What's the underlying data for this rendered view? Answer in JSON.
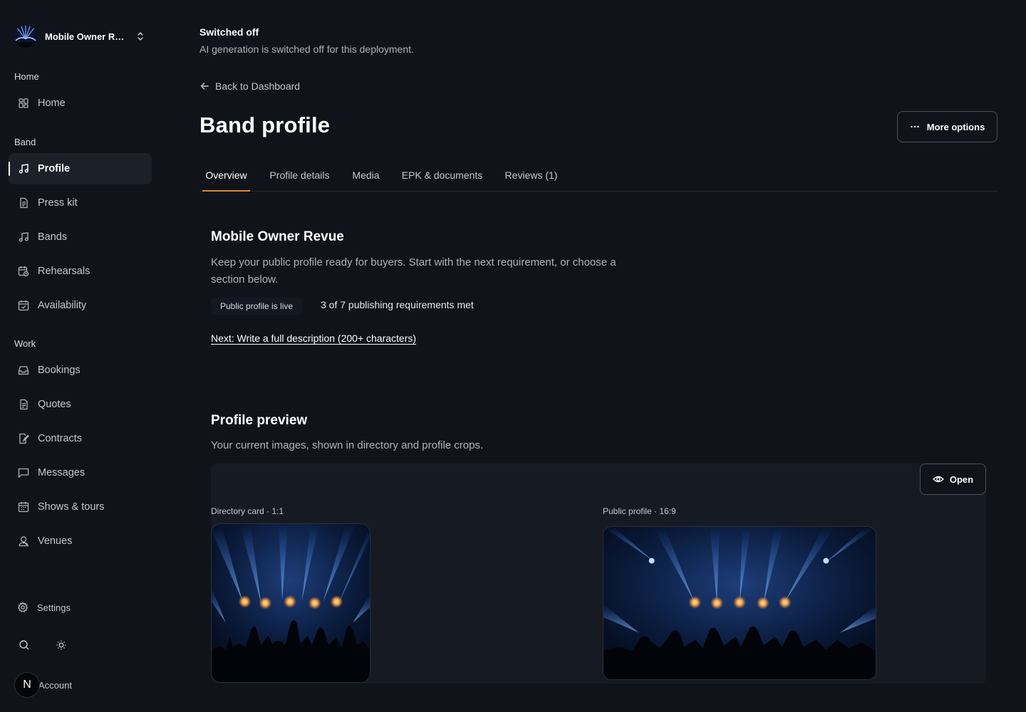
{
  "workspace": {
    "name": "Mobile Owner Revue",
    "logo_icon": "band-logo-icon",
    "switch_icon": "chevron-up-down-icon"
  },
  "sidebar": {
    "sections": [
      {
        "label": "Home"
      },
      {
        "label": "Band"
      },
      {
        "label": "Work"
      }
    ],
    "items": [
      {
        "label": "Home",
        "icon": "grid-icon"
      },
      {
        "label": "Profile",
        "icon": "music-note-icon",
        "active": true
      },
      {
        "label": "Press kit",
        "icon": "document-icon"
      },
      {
        "label": "Bands",
        "icon": "music-note-icon"
      },
      {
        "label": "Rehearsals",
        "icon": "calendar-clock-icon"
      },
      {
        "label": "Availability",
        "icon": "calendar-check-icon"
      },
      {
        "label": "Bookings",
        "icon": "inbox-icon"
      },
      {
        "label": "Quotes",
        "icon": "document-icon"
      },
      {
        "label": "Contracts",
        "icon": "document-edit-icon"
      },
      {
        "label": "Messages",
        "icon": "message-icon"
      },
      {
        "label": "Shows & tours",
        "icon": "calendar-icon"
      },
      {
        "label": "Venues",
        "icon": "user-pin-icon"
      }
    ],
    "settings_label": "Settings",
    "account_label": "Account",
    "avatar_initial": "N"
  },
  "notice": {
    "title": "Switched off",
    "text": "AI generation is switched off for this deployment."
  },
  "back_link": "Back to Dashboard",
  "page_title": "Band profile",
  "more_options_label": "More options",
  "tabs": [
    {
      "label": "Overview",
      "active": true
    },
    {
      "label": "Profile details"
    },
    {
      "label": "Media"
    },
    {
      "label": "EPK & documents"
    },
    {
      "label": "Reviews (1)"
    }
  ],
  "overview": {
    "band_name": "Mobile Owner Revue",
    "intro": "Keep your public profile ready for buyers. Start with the next requirement, or choose a section below.",
    "status_badge": "Public profile is live",
    "requirements": "3 of 7 publishing requirements met",
    "next_link": "Next: Write a full description (200+ characters)"
  },
  "preview": {
    "title": "Profile preview",
    "subtitle": "Your current images, shown in directory and profile crops.",
    "open_label": "Open",
    "directory_label": "Directory card · 1:1",
    "profile_label": "Public profile · 16:9"
  },
  "colors": {
    "accent": "#d98b3a",
    "background": "#10131a",
    "panel": "#161a22",
    "active_nav": "#1c2029"
  }
}
